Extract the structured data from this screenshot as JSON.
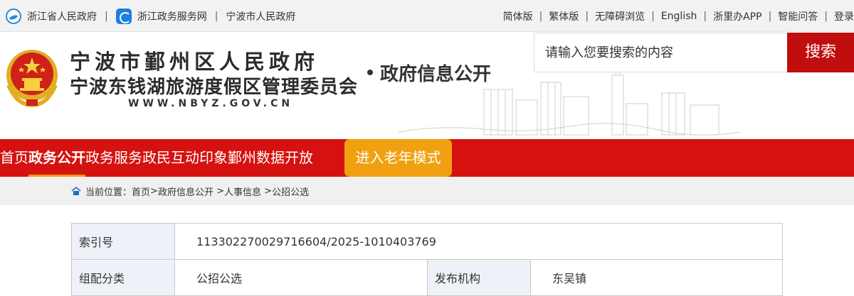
{
  "topbar": {
    "left_links": [
      {
        "label": "浙江省人民政府",
        "icon": "zhejiang-gov-icon"
      },
      {
        "label": "浙江政务服务网",
        "icon": "zjzwfw-icon"
      },
      {
        "label": "宁波市人民政府"
      }
    ],
    "right_links": [
      "简体版",
      "繁体版",
      "无障碍浏览",
      "English",
      "浙里办APP",
      "智能问答",
      "登录"
    ]
  },
  "header": {
    "title_line1": "宁波市鄞州区人民政府",
    "title_line2": "宁波东钱湖旅游度假区管理委员会",
    "domain": "WWW.NBYZ.GOV.CN",
    "subtitle": "政府信息公开",
    "search_placeholder": "请输入您要搜索的内容",
    "search_button": "搜索"
  },
  "nav": {
    "items": [
      "首页",
      "政务公开",
      "政务服务",
      "政民互动",
      "印象鄞州",
      "数据开放"
    ],
    "active_index": 1,
    "elder_mode": "进入老年模式"
  },
  "breadcrumb": {
    "prefix": "当前位置：",
    "items": [
      "首页",
      "政府信息公开",
      "人事信息",
      "公招公选"
    ],
    "separator": "> "
  },
  "info_table": {
    "index_label": "索引号",
    "index_value": "113302270029716604/2025-1010403769",
    "category_label": "组配分类",
    "category_value": "公招公选",
    "publisher_label": "发布机构",
    "publisher_value": "东吴镇"
  },
  "colors": {
    "nav_red": "#d5120f",
    "search_red": "#c00d0d",
    "elder_orange": "#f0a010"
  }
}
